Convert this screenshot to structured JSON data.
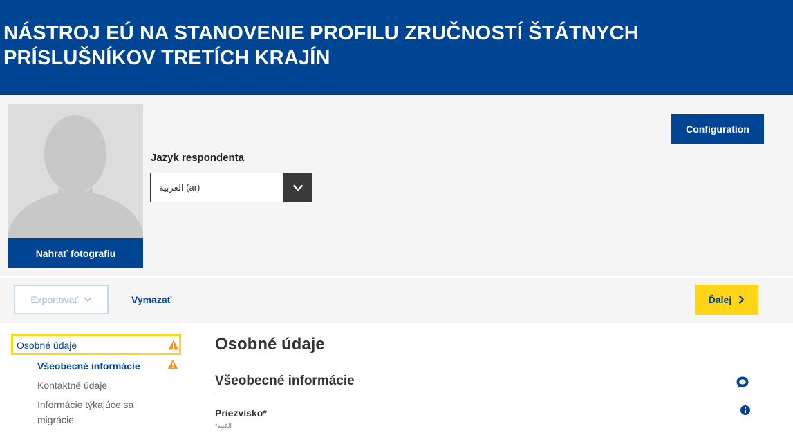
{
  "header": {
    "title": "NÁSTROJ EÚ NA STANOVENIE PROFILU ZRUČNOSTÍ ŠTÁTNYCH PRÍSLUŠNÍKOV TRETÍCH KRAJÍN"
  },
  "profile": {
    "upload_photo_label": "Nahrať fotografiu",
    "language_label": "Jazyk respondenta",
    "language_value": "العربية (ar)",
    "configuration_label": "Configuration"
  },
  "actions": {
    "export_label": "Exportovať",
    "clear_label": "Vymazať",
    "next_label": "Ďalej"
  },
  "sidebar": {
    "items": [
      {
        "label": "Osobné údaje",
        "warning": true
      },
      {
        "label": "Všeobecné informácie",
        "warning": true
      },
      {
        "label": "Kontaktné údaje",
        "warning": false
      },
      {
        "label": "Informácie týkajúce sa",
        "label2": "migrácie",
        "warning": false
      }
    ]
  },
  "main": {
    "title": "Osobné údaje",
    "section_title": "Všeobecné informácie",
    "fields": [
      {
        "label": "Priezvisko*",
        "sublabel": "*الكنية"
      }
    ]
  },
  "colors": {
    "brand": "#004494",
    "accent": "#ffd617",
    "warning": "#f29527",
    "background": "#f5f5f5"
  },
  "icons": {
    "language_dropdown": "chevron-down-icon",
    "export": "chevron-down-icon",
    "next": "chevron-right-icon",
    "warning": "warning-triangle-icon",
    "comment": "speech-bubble-icon",
    "info": "info-icon"
  }
}
